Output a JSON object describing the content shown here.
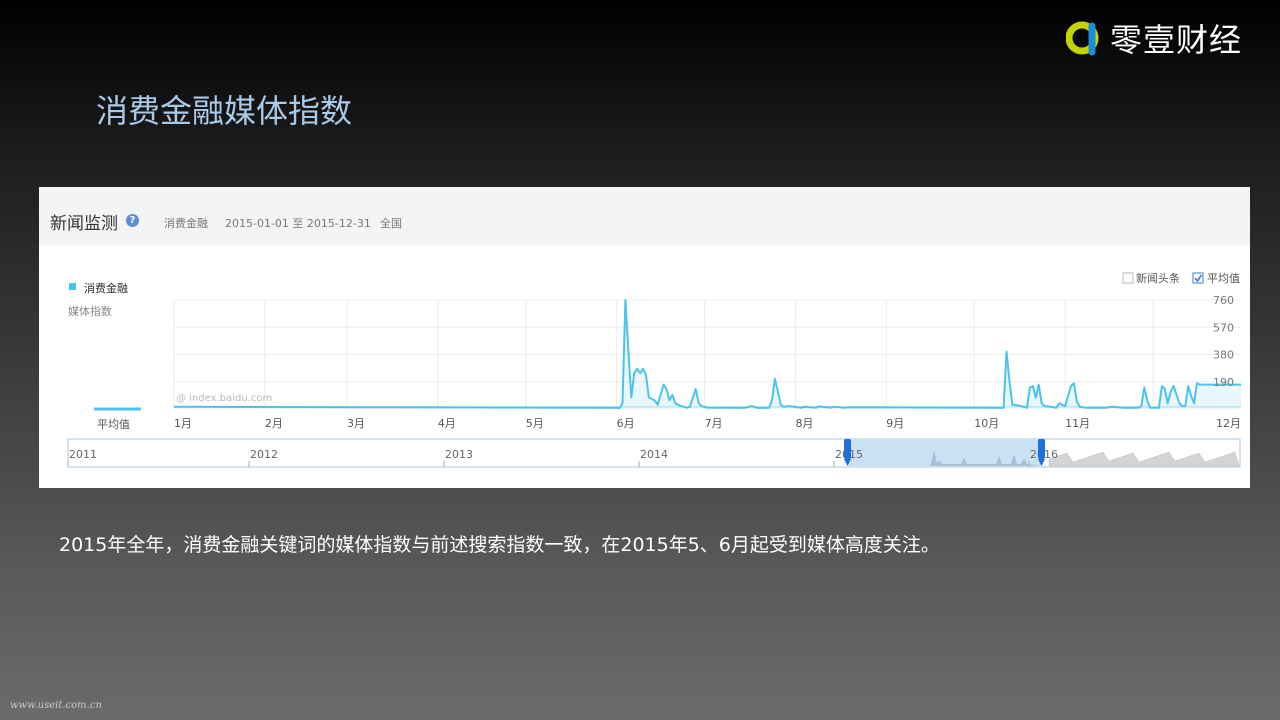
{
  "brand": {
    "logo_text": "零壹财经",
    "colors": {
      "icon_yellow": "#c4d400",
      "icon_blue": "#1b8fd6"
    }
  },
  "slide": {
    "title": "消费金融媒体指数"
  },
  "panel": {
    "title": "新闻监测",
    "help_icon": "?",
    "keyword": "消费金融",
    "date_range": "2015-01-01 至 2015-12-31",
    "region": "全国",
    "options": {
      "news_headline_label": "新闻头条",
      "news_headline_checked": false,
      "average_label": "平均值",
      "average_checked": true
    },
    "watermark": "@ index.baidu.com",
    "average_label": "平均值"
  },
  "chart_data": {
    "type": "line",
    "title": "",
    "legend": [
      "消费金融"
    ],
    "ylabel": "媒体指数",
    "xlabel": "",
    "color": "#4cc3ea",
    "ylim": [
      0,
      760
    ],
    "yticks": [
      760,
      570,
      380,
      190
    ],
    "x_axis": {
      "start": "2015-01-01",
      "end": "2015-12-31",
      "month_labels": [
        "1月",
        "2月",
        "3月",
        "4月",
        "5月",
        "6月",
        "7月",
        "8月",
        "9月",
        "10月",
        "11月",
        "12月"
      ]
    },
    "series": [
      {
        "name": "消费金融",
        "values": [
          [
            152,
            5
          ],
          [
            153,
            40
          ],
          [
            154,
            760
          ],
          [
            155,
            400
          ],
          [
            156,
            80
          ],
          [
            157,
            250
          ],
          [
            158,
            280
          ],
          [
            159,
            250
          ],
          [
            160,
            280
          ],
          [
            161,
            240
          ],
          [
            162,
            80
          ],
          [
            164,
            60
          ],
          [
            165,
            30
          ],
          [
            167,
            170
          ],
          [
            168,
            140
          ],
          [
            169,
            60
          ],
          [
            170,
            100
          ],
          [
            171,
            40
          ],
          [
            172,
            30
          ],
          [
            173,
            20
          ],
          [
            176,
            15
          ],
          [
            177,
            80
          ],
          [
            178,
            140
          ],
          [
            179,
            40
          ],
          [
            180,
            20
          ],
          [
            182,
            10
          ],
          [
            195,
            10
          ],
          [
            197,
            20
          ],
          [
            199,
            8
          ],
          [
            204,
            60
          ],
          [
            205,
            210
          ],
          [
            206,
            120
          ],
          [
            207,
            30
          ],
          [
            208,
            15
          ],
          [
            210,
            20
          ],
          [
            215,
            15
          ],
          [
            220,
            18
          ],
          [
            225,
            15
          ],
          [
            230,
            12
          ],
          [
            283,
            8
          ],
          [
            284,
            400
          ],
          [
            285,
            200
          ],
          [
            286,
            30
          ],
          [
            288,
            25
          ],
          [
            289,
            20
          ],
          [
            292,
            150
          ],
          [
            293,
            160
          ],
          [
            294,
            80
          ],
          [
            295,
            170
          ],
          [
            296,
            40
          ],
          [
            297,
            20
          ],
          [
            299,
            15
          ],
          [
            302,
            40
          ],
          [
            304,
            20
          ],
          [
            306,
            160
          ],
          [
            307,
            180
          ],
          [
            308,
            50
          ],
          [
            309,
            15
          ],
          [
            312,
            10
          ],
          [
            318,
            10
          ],
          [
            320,
            15
          ],
          [
            325,
            10
          ],
          [
            330,
            20
          ],
          [
            331,
            150
          ],
          [
            332,
            60
          ],
          [
            333,
            10
          ],
          [
            337,
            160
          ],
          [
            338,
            140
          ],
          [
            339,
            40
          ],
          [
            340,
            120
          ],
          [
            341,
            160
          ],
          [
            342,
            100
          ],
          [
            343,
            40
          ],
          [
            344,
            20
          ],
          [
            345,
            20
          ],
          [
            346,
            160
          ],
          [
            347,
            90
          ],
          [
            348,
            40
          ],
          [
            349,
            180
          ],
          [
            350,
            170
          ]
        ]
      }
    ],
    "average": 15,
    "navigator": {
      "years": [
        "2011",
        "2012",
        "2013",
        "2014",
        "2015",
        "2016"
      ],
      "selected": [
        "2015-01-01",
        "2015-12-31"
      ]
    }
  },
  "copy_text": "2015年全年，消费金融关键词的媒体指数与前述搜索指数一致，在2015年5、6月起受到媒体高度关注。",
  "footer": {
    "watermark": "www.useit.com.cn"
  }
}
